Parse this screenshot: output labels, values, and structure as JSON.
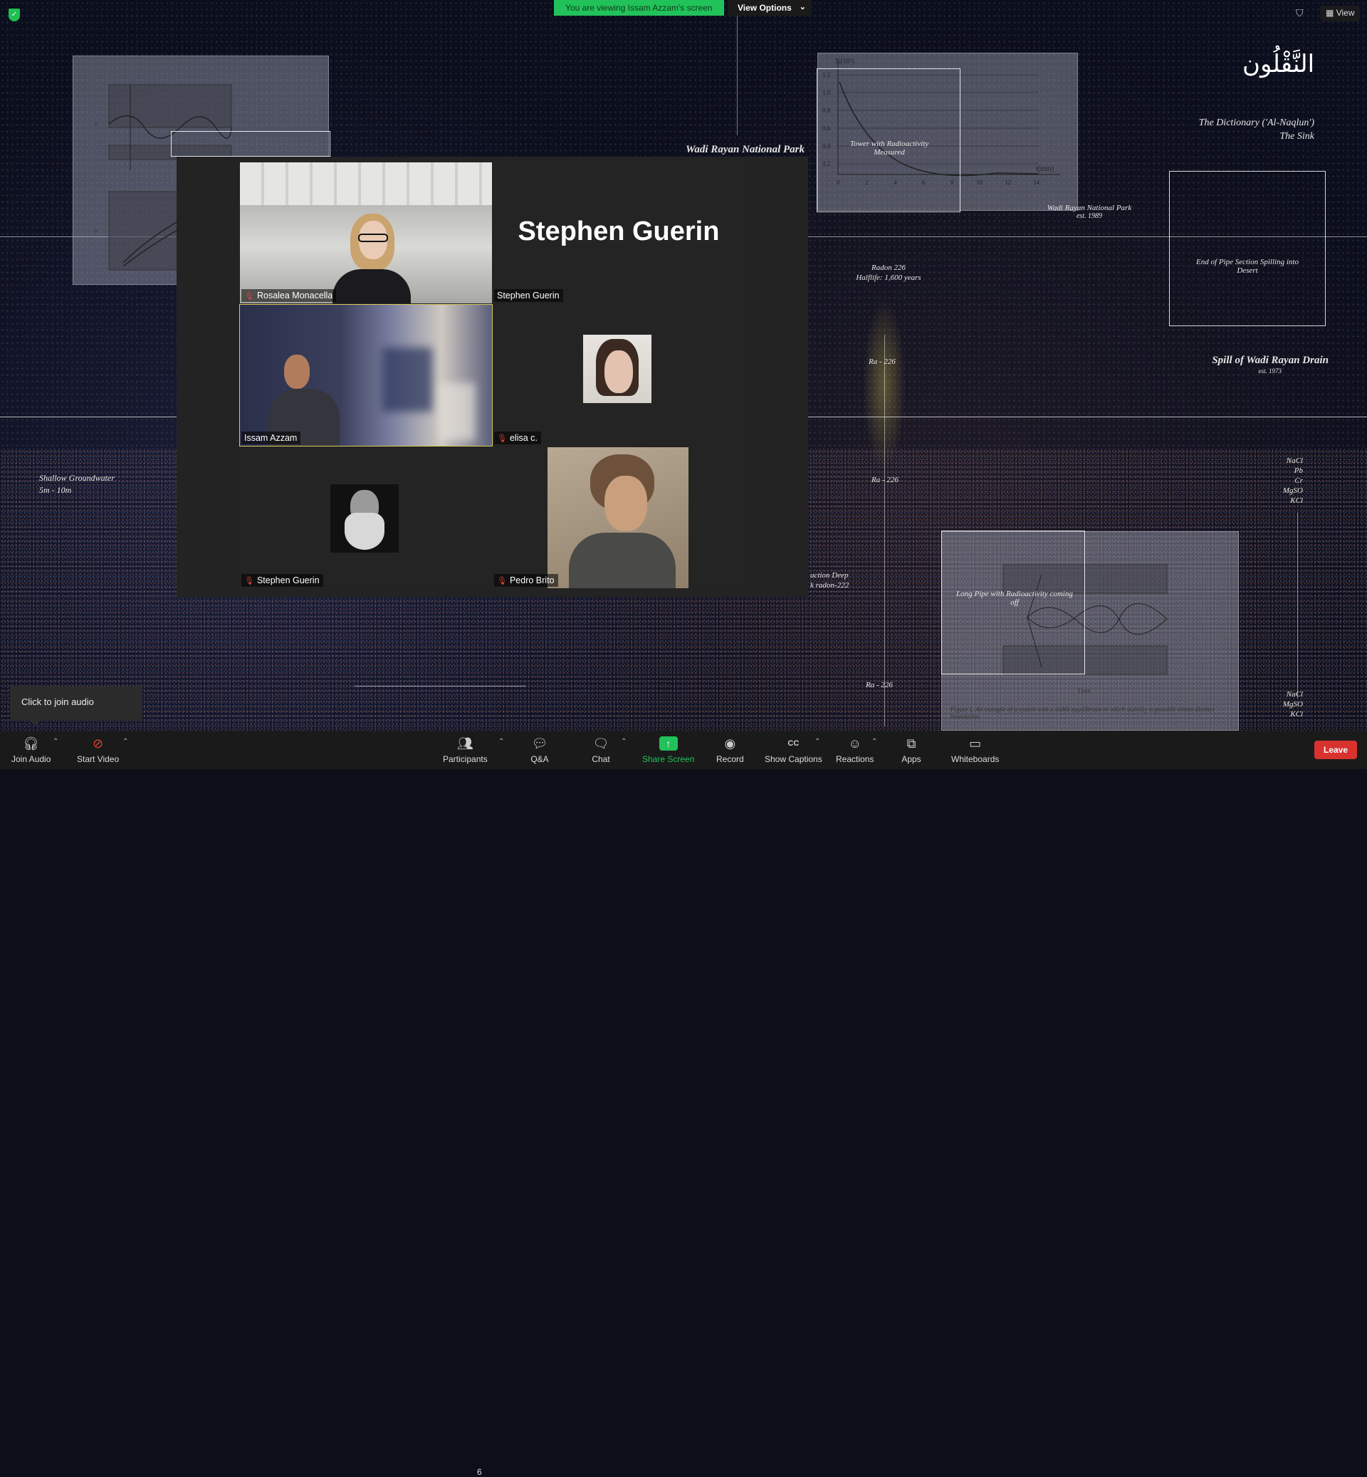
{
  "share_banner": "You are viewing Issam Azzam's screen",
  "view_options": "View Options",
  "top_right": {
    "view_label": "View"
  },
  "shared_content": {
    "arabic_title": "النَّقْلُون",
    "dictionary_line1": "The Dictionary ('Al-Naqlun')",
    "dictionary_line2": "The Sink",
    "wadi_title": "Wadi Rayan National Park",
    "park_label_line1": "Wadi Rayan National Park",
    "park_label_line2": "est. 1989",
    "tower_label": "Tower with Radioactivity Measured",
    "radon_line1": "Radon 226",
    "radon_line2": "Halflife: 1,600 years",
    "ra226_a": "Ra - 226",
    "ra226_b": "Ra - 226",
    "ra226_c": "Ra - 226",
    "pipe_label": "End of Pipe Section Spilling into Desert",
    "spill_title": "Spill of Wadi Rayan Drain",
    "spill_est": "est. 1973",
    "groundwater_line1": "Shallow Groundwater",
    "groundwater_line2": "5m - 10m",
    "long_pipe_label": "Long Pipe with Radioactivity coming off",
    "fraction_line1": "action Deep",
    "fraction_line2": "k radon-222",
    "chem_list_1": [
      "NaCl",
      "Pb",
      "Cr",
      "MgSO",
      "KCl"
    ],
    "chem_list_2": [
      "NaCl",
      "MgSO",
      "KCl"
    ],
    "figure_caption": "Figure 1. An example of a system with a stable equilibrium in which stability is possible within distinct boundaries.",
    "graph_axis_y": "N(10³)",
    "graph_axis_x": "t(min)",
    "graph_ticks_x": [
      "0",
      "2",
      "4",
      "6",
      "8",
      "10",
      "12",
      "14"
    ],
    "graph_ticks_y": [
      "1.2",
      "1.0",
      "0.8",
      "0.6",
      "0.4",
      "0.2"
    ],
    "time_label": "Time"
  },
  "gallery": {
    "speaker_big_name": "Stephen Guerin",
    "tiles": [
      {
        "name": "Rosalea Monacella",
        "muted": true
      },
      {
        "name": "Stephen Guerin",
        "muted": false
      },
      {
        "name": "Issam Azzam",
        "muted": false
      },
      {
        "name": "elisa c.",
        "muted": true
      },
      {
        "name": "Stephen Guerin",
        "muted": true
      },
      {
        "name": "Pedro Brito",
        "muted": true
      }
    ]
  },
  "tooltip": "Click to join audio",
  "toolbar": {
    "join_audio": "Join Audio",
    "start_video": "Start Video",
    "participants": "Participants",
    "participants_count": "6",
    "qa": "Q&A",
    "chat": "Chat",
    "share_screen": "Share Screen",
    "record": "Record",
    "show_captions": "Show Captions",
    "reactions": "Reactions",
    "apps": "Apps",
    "whiteboards": "Whiteboards",
    "leave": "Leave"
  },
  "colors": {
    "share_green": "#22c25a",
    "leave_red": "#d8322f",
    "active_speaker": "#d9c95c"
  }
}
